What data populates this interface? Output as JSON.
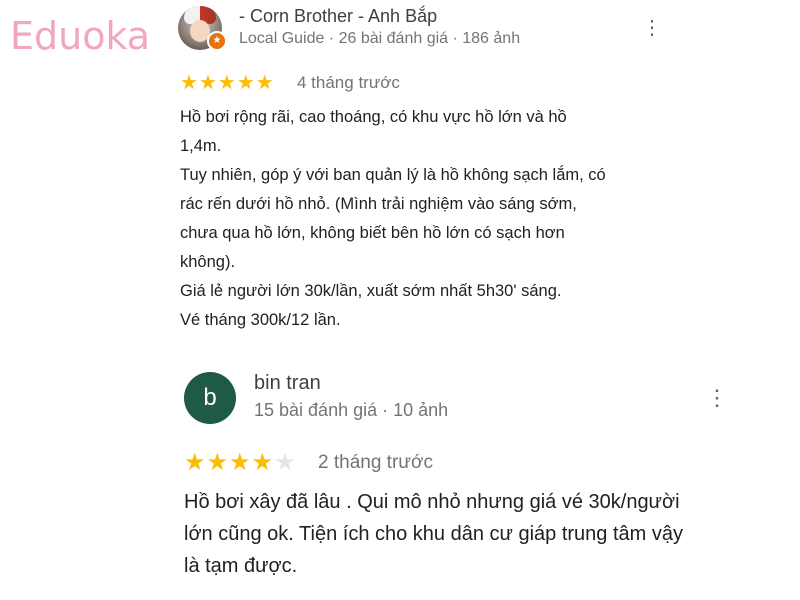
{
  "logo": "Eduoka",
  "colors": {
    "star": "#fbbc04",
    "star_empty": "#e6e6e6",
    "avatar_b": "#1f5a45",
    "logo": "#f1a7c3"
  },
  "reviews": [
    {
      "name": "- Corn Brother - Anh Bắp",
      "meta": "Local Guide · 26 bài đánh giá · 186 ảnh",
      "rating": 5,
      "time": "4 tháng trước",
      "lines": [
        "Hồ bơi rộng rãi, cao thoáng, có khu vực hồ lớn và hồ",
        "1,4m.",
        "Tuy nhiên, góp ý với ban quản lý là hồ không sạch lắm, có",
        "rác rến dưới hồ nhỏ. (Mình trải nghiệm vào sáng sớm,",
        "chưa qua hồ lớn, không biết bên hồ lớn có sạch hơn",
        "không).",
        "Giá lẻ người lớn 30k/lần, xuất sớm nhất 5h30' sáng.",
        "Vé tháng 300k/12 lần."
      ],
      "more_icon": "more-vert-icon"
    },
    {
      "name": "bin tran",
      "avatar_letter": "b",
      "meta": "15 bài đánh giá · 10 ảnh",
      "rating": 4,
      "time": "2 tháng trước",
      "lines": [
        "Hồ bơi xây đã lâu . Qui mô nhỏ nhưng giá vé 30k/người",
        "lớn cũng ok. Tiện ích cho khu dân cư giáp trung tâm vậy",
        "là tạm được."
      ],
      "more_icon": "more-vert-icon"
    }
  ]
}
